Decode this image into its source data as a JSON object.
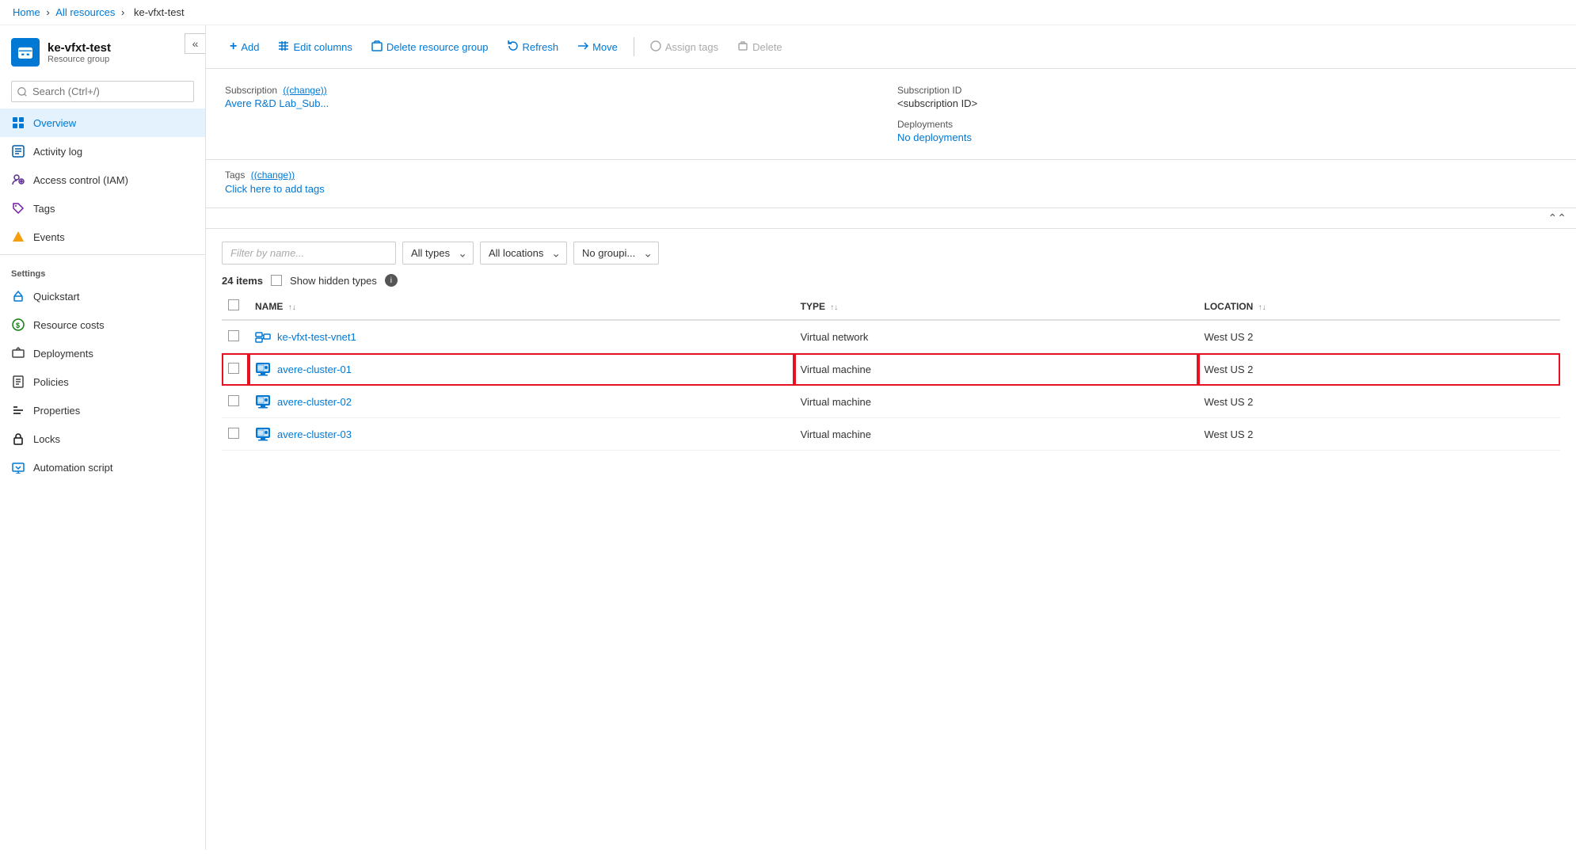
{
  "topbar": {
    "title": ""
  },
  "breadcrumb": {
    "home": "Home",
    "all_resources": "All resources",
    "current": "ke-vfxt-test"
  },
  "sidebar": {
    "resource_name": "ke-vfxt-test",
    "resource_type": "Resource group",
    "search_placeholder": "Search (Ctrl+/)",
    "nav_items": [
      {
        "id": "overview",
        "label": "Overview",
        "icon": "overview",
        "active": true
      },
      {
        "id": "activity-log",
        "label": "Activity log",
        "icon": "activity"
      },
      {
        "id": "iam",
        "label": "Access control (IAM)",
        "icon": "iam"
      },
      {
        "id": "tags",
        "label": "Tags",
        "icon": "tags"
      },
      {
        "id": "events",
        "label": "Events",
        "icon": "events"
      }
    ],
    "settings_label": "Settings",
    "settings_items": [
      {
        "id": "quickstart",
        "label": "Quickstart",
        "icon": "quickstart"
      },
      {
        "id": "resource-costs",
        "label": "Resource costs",
        "icon": "costs"
      },
      {
        "id": "deployments",
        "label": "Deployments",
        "icon": "deployments"
      },
      {
        "id": "policies",
        "label": "Policies",
        "icon": "policies"
      },
      {
        "id": "properties",
        "label": "Properties",
        "icon": "properties"
      },
      {
        "id": "locks",
        "label": "Locks",
        "icon": "locks"
      },
      {
        "id": "automation-script",
        "label": "Automation script",
        "icon": "automation"
      }
    ]
  },
  "toolbar": {
    "add_label": "Add",
    "edit_columns_label": "Edit columns",
    "delete_rg_label": "Delete resource group",
    "refresh_label": "Refresh",
    "move_label": "Move",
    "assign_tags_label": "Assign tags",
    "delete_label": "Delete"
  },
  "info": {
    "subscription_label": "Subscription",
    "subscription_change": "(change)",
    "subscription_value": "Avere R&D Lab_Sub...",
    "subscription_id_label": "Subscription ID",
    "subscription_id_value": "<subscription ID>",
    "deployments_label": "Deployments",
    "deployments_value": "No deployments",
    "tags_label": "Tags",
    "tags_change": "(change)",
    "tags_add": "Click here to add tags"
  },
  "resources": {
    "filter_placeholder": "Filter by name...",
    "all_types_label": "All types",
    "all_locations_label": "All locations",
    "no_grouping_label": "No groupi...",
    "item_count": "24 items",
    "show_hidden_label": "Show hidden types",
    "columns": [
      {
        "id": "name",
        "label": "NAME"
      },
      {
        "id": "type",
        "label": "TYPE"
      },
      {
        "id": "location",
        "label": "LOCATION"
      }
    ],
    "rows": [
      {
        "id": "vnet1",
        "name": "ke-vfxt-test-vnet1",
        "type": "Virtual network",
        "location": "West US 2",
        "icon": "vnet",
        "highlighted": false
      },
      {
        "id": "cluster01",
        "name": "avere-cluster-01",
        "type": "Virtual machine",
        "location": "West US 2",
        "icon": "vm",
        "highlighted": true
      },
      {
        "id": "cluster02",
        "name": "avere-cluster-02",
        "type": "Virtual machine",
        "location": "West US 2",
        "icon": "vm",
        "highlighted": false
      },
      {
        "id": "cluster03",
        "name": "avere-cluster-03",
        "type": "Virtual machine",
        "location": "West US 2",
        "icon": "vm",
        "highlighted": false
      }
    ]
  }
}
